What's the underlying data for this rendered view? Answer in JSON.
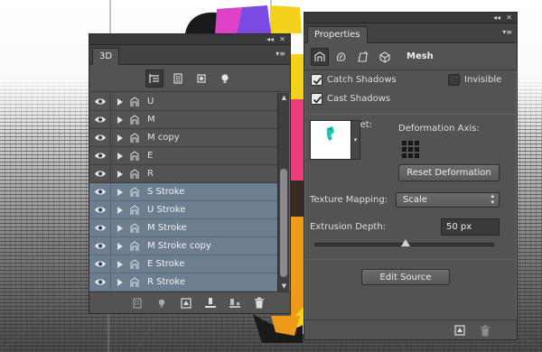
{
  "app": {
    "accent_selected": "#6e7e91",
    "panel_bg": "#535353"
  },
  "panel3d": {
    "tab_label": "3D",
    "collapse_glyph": "◂◂",
    "close_glyph": "✕",
    "menu_glyph": "▾≡",
    "toolbar_icons": [
      "whole-scene-icon",
      "meshes-icon",
      "materials-icon",
      "lights-icon"
    ],
    "layers": [
      {
        "name": "U",
        "selected": false
      },
      {
        "name": "M",
        "selected": false
      },
      {
        "name": "M copy",
        "selected": false
      },
      {
        "name": "E",
        "selected": false
      },
      {
        "name": "R",
        "selected": false
      },
      {
        "name": "S Stroke",
        "selected": true
      },
      {
        "name": "U Stroke",
        "selected": true
      },
      {
        "name": "M Stroke",
        "selected": true
      },
      {
        "name": "M Stroke copy",
        "selected": true
      },
      {
        "name": "E Stroke",
        "selected": true
      },
      {
        "name": "R Stroke",
        "selected": true
      }
    ],
    "footer_icons": [
      "render-icon",
      "light-add-icon",
      "material-icon",
      "drop-to-ground-icon",
      "split-icon",
      "trash-icon"
    ]
  },
  "properties": {
    "tab_label": "Properties",
    "collapse_glyph": "◂◂",
    "close_glyph": "✕",
    "menu_glyph": "▾≡",
    "mesh_label": "Mesh",
    "catch_shadows_label": "Catch Shadows",
    "catch_shadows_checked": true,
    "invisible_label": "Invisible",
    "invisible_checked": false,
    "cast_shadows_label": "Cast Shadows",
    "cast_shadows_checked": true,
    "shape_preset_label": "Shape Preset:",
    "deformation_axis_label": "Deformation Axis:",
    "reset_deformation_label": "Reset Deformation",
    "texture_mapping_label": "Texture Mapping:",
    "texture_mapping_value": "Scale",
    "extrusion_depth_label": "Extrusion Depth:",
    "extrusion_depth_value": "50 px",
    "extrusion_slider_fraction": 0.51,
    "edit_source_label": "Edit Source"
  }
}
